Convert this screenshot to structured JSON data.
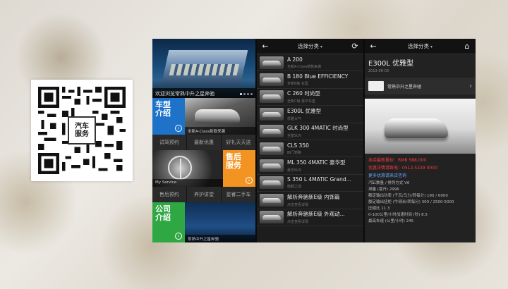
{
  "qr": {
    "center_label_line1": "汽车",
    "center_label_line2": "服务"
  },
  "phone1": {
    "hero_caption": "欢迎浏览常熟中升之星奔驰",
    "tiles": {
      "cars_line1": "车型",
      "cars_line2": "介绍",
      "cars_img_caption": "全新A-Class新款来袭",
      "after_line1": "售后",
      "after_line2": "服务",
      "after_img_caption": "My Service",
      "company_line1": "公司",
      "company_line2": "介绍",
      "company_img_caption": "常熟中升之星奔驰"
    },
    "menu1": [
      "试驾预约",
      "最新优惠",
      "好礼天天送"
    ],
    "menu2": [
      "售后预约",
      "养护讲堂",
      "星睿二手车"
    ]
  },
  "phone2": {
    "title": "选择分类",
    "items": [
      {
        "title": "A 200",
        "sub": "全新A-Class新款来袭"
      },
      {
        "title": "B 180 Blue EFFICIENCY",
        "sub": "全新B级 车型"
      },
      {
        "title": "C 260 时尚型",
        "sub": "全新C级 豪华车型"
      },
      {
        "title": "E300L 优雅型",
        "sub": "优雅大气"
      },
      {
        "title": "GLK 300 4MATIC 时尚型",
        "sub": "全能SUV"
      },
      {
        "title": "CLS 350",
        "sub": "四门轿跑"
      },
      {
        "title": "ML 350 4MATIC 豪华型",
        "sub": "豪华SUV"
      },
      {
        "title": "S 350 L 4MATIC Grand...",
        "sub": "旗舰之选"
      },
      {
        "title": "解析奔驰新E级 内饰篇",
        "sub": "点击查看详情"
      },
      {
        "title": "解析奔驰新E级 外观动...",
        "sub": "点击查看详情"
      }
    ]
  },
  "phone3": {
    "title": "选择分类",
    "car_title": "E300L 优雅型",
    "date": "2013-06-03",
    "dealer_name": "常熟中升之星奔驰",
    "price": "本店最新报价：RMB  588,000",
    "phone": "优惠详情请致电：0512-5229 0000",
    "link": "更多优惠请来店咨询",
    "specs": [
      "汽缸数量 / 排列方式    V6",
      "排量 (毫升)    2996",
      "额定输出功率 (千瓦/马力/转每分)    180 / 6000",
      "额定输出扭矩 (牛顿米/转每分)    300 / 2500-5000",
      "压缩比    11.3",
      "0-100公里/小时加速时间 (秒)    8.5",
      "最高车速 (公里/小时)    245"
    ]
  }
}
